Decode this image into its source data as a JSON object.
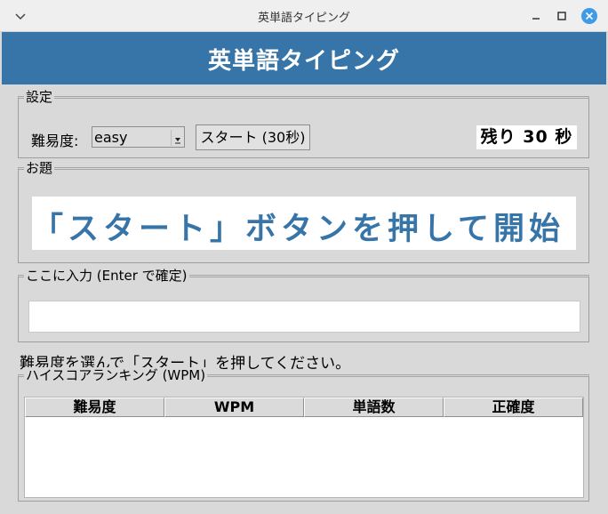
{
  "window": {
    "title": "英単語タイピング"
  },
  "header": {
    "title": "英単語タイピング"
  },
  "settings": {
    "group_label": "設定",
    "difficulty_label": "難易度:",
    "difficulty_value": "easy",
    "start_label": "スタート (30秒)",
    "timer_text": "残り 30 秒"
  },
  "prompt": {
    "group_label": "お題",
    "text": "「スタート」ボタンを押して開始"
  },
  "input": {
    "group_label": "ここに入力 (Enter で確定)",
    "value": ""
  },
  "status": {
    "text": "難易度を選んで「スタート」を押してください。"
  },
  "ranking": {
    "group_label": "ハイスコアランキング (WPM)",
    "columns": [
      "難易度",
      "WPM",
      "単語数",
      "正確度"
    ],
    "rows": []
  },
  "colors": {
    "accent": "#3775a9",
    "close_button": "#3d9be9"
  }
}
